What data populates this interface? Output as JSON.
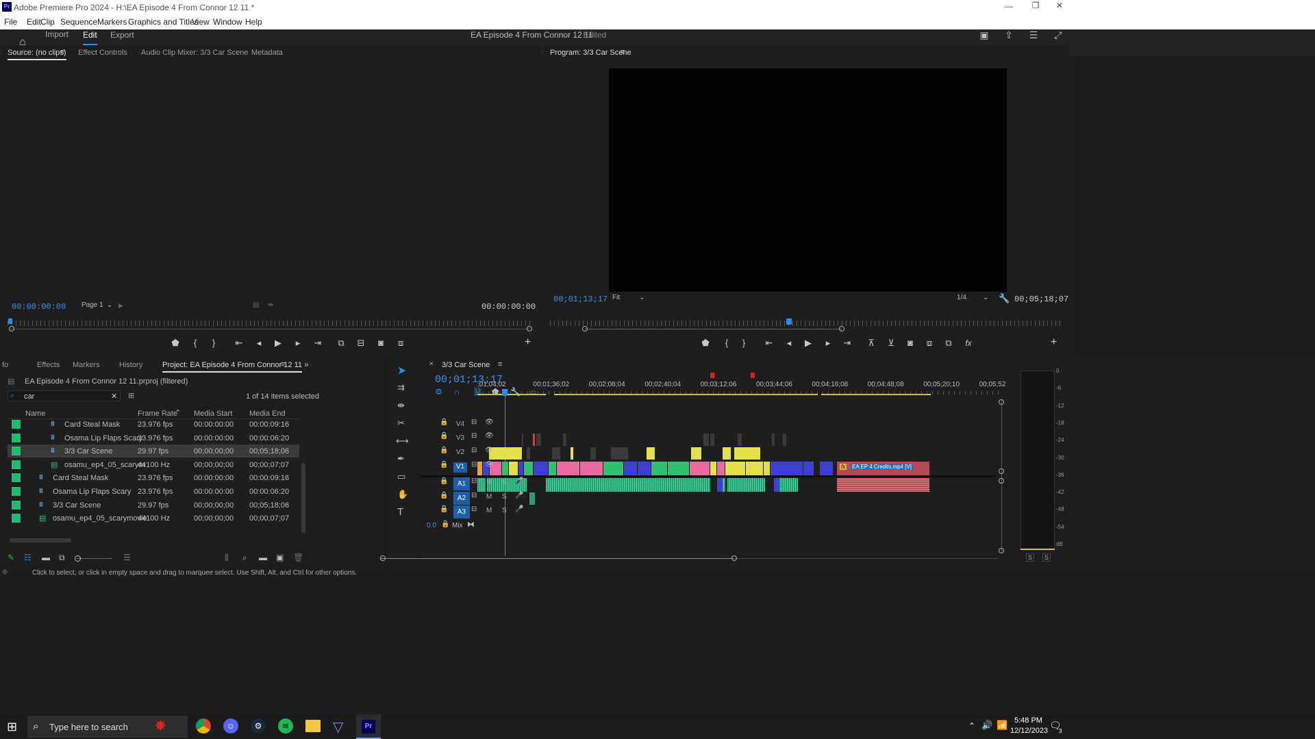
{
  "app": {
    "title": "Adobe Premiere Pro 2024 - H:\\EA Episode 4 From Connor 12 11 *",
    "icon_label": "Pr"
  },
  "menu": [
    "File",
    "Edit",
    "Clip",
    "Sequence",
    "Markers",
    "Graphics and Titles",
    "View",
    "Window",
    "Help"
  ],
  "workspace": {
    "tabs": [
      "Import",
      "Edit",
      "Export"
    ],
    "active_tab": "Edit",
    "project_title": "EA Episode 4 From Connor 12 11",
    "edited_label": "- Edited"
  },
  "source_panel": {
    "tabs": [
      "Source: (no clips)",
      "Effect Controls",
      "Audio Clip Mixer: 3/3 Car Scene",
      "Metadata"
    ],
    "timecode_left": "00:00:00:00",
    "page_select": "Page 1",
    "timecode_right": "00:00:00:00"
  },
  "program_panel": {
    "tab": "Program: 3/3 Car Scene",
    "timecode": "00;01;13;17",
    "fit_select": "Fit",
    "quality_select": "1/4",
    "duration": "00;05;18;07",
    "playhead_fraction": 0.46
  },
  "project_panel": {
    "tabs": [
      "fo",
      "Effects",
      "Markers",
      "History",
      "Project: EA Episode 4 From Connor 12 11"
    ],
    "filename": "EA Episode 4 From Connor 12 11.prproj (filtered)",
    "search_value": "car",
    "selection_status": "1 of 14 items selected",
    "columns": [
      "Name",
      "Frame Rate",
      "Media Start",
      "Media End"
    ],
    "rows": [
      {
        "name": "Card Steal Mask",
        "rate": "23.976 fps",
        "start": "00:00:00:00",
        "end": "00:00:09:16",
        "indent": true,
        "type": "seq",
        "selected": false
      },
      {
        "name": "Osama Lip Flaps Scary",
        "rate": "23.976 fps",
        "start": "00:00:00:00",
        "end": "00:00:06:20",
        "indent": true,
        "type": "seq",
        "selected": false
      },
      {
        "name": "3/3 Car Scene",
        "rate": "29.97 fps",
        "start": "00;00;00;00",
        "end": "00;05;18;06",
        "indent": true,
        "type": "seq",
        "selected": true
      },
      {
        "name": "osamu_ep4_05_scarym",
        "rate": "44100 Hz",
        "start": "00;00;00;00",
        "end": "00;00;07;07",
        "indent": true,
        "type": "audio",
        "selected": false
      },
      {
        "name": "Card Steal Mask",
        "rate": "23.976 fps",
        "start": "00:00:00:00",
        "end": "00:00:09:16",
        "indent": false,
        "type": "seq",
        "selected": false
      },
      {
        "name": "Osama Lip Flaps Scary",
        "rate": "23.976 fps",
        "start": "00:00:00:00",
        "end": "00:00:06:20",
        "indent": false,
        "type": "seq",
        "selected": false
      },
      {
        "name": "3/3 Car Scene",
        "rate": "29.97 fps",
        "start": "00;00;00;00",
        "end": "00;05;18;06",
        "indent": false,
        "type": "seq",
        "selected": false
      },
      {
        "name": "osamu_ep4_05_scarymovie",
        "rate": "44100 Hz",
        "start": "00;00;00;00",
        "end": "00;00;07;07",
        "indent": false,
        "type": "audio",
        "selected": false
      }
    ]
  },
  "timeline": {
    "tab": "3/3 Car Scene",
    "timecode": "00;01;13;17",
    "ruler": [
      ";01;04;02",
      "00;01;36;02",
      "00;02;08;04",
      "00;02;40;04",
      "00;03;12;06",
      "00;03;44;06",
      "00;04;16;08",
      "00;04;48;08",
      "00;05;20;10",
      "00;05;52"
    ],
    "video_tracks": [
      "V4",
      "V3",
      "V2",
      "V1"
    ],
    "audio_tracks": [
      "A1",
      "A2",
      "A3"
    ],
    "audio_buttons": {
      "mute": "M",
      "solo": "S"
    },
    "mix_label": "Mix",
    "mix_value": "0.0",
    "credits_clip": "EA EP 4 Credits.mp4 [V]",
    "fx_badge": "fx"
  },
  "meter": {
    "scale": [
      "0",
      "-6",
      "-12",
      "-18",
      "-24",
      "-30",
      "-36",
      "-42",
      "-48",
      "-54",
      "dB"
    ],
    "solo_labels": [
      "S",
      "S"
    ]
  },
  "status_bar": "Click to select, or click in empty space and drag to marquee select. Use Shift, Alt, and Ctrl for other options.",
  "taskbar": {
    "search_placeholder": "Type here to search",
    "time": "5:48 PM",
    "date": "12/12/2023",
    "notification_count": "3",
    "pr_label": "Pr"
  },
  "colors": {
    "accent_blue": "#2d8ceb",
    "yellow": "#e4e04a",
    "pink": "#e86aa0",
    "green": "#30c070",
    "dark_blue": "#3f3fd8",
    "audio_green": "#2a9d74",
    "credits_red": "#b44c56"
  }
}
